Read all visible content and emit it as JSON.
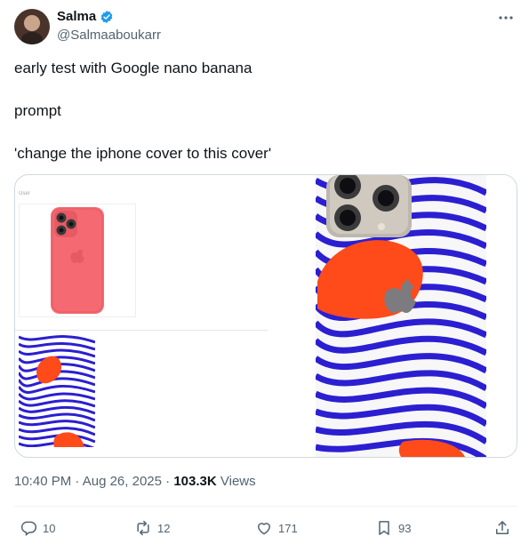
{
  "tweet": {
    "author_name": "Salma",
    "author_handle": "@Salmaaboukarr",
    "text_lines": [
      "early test with Google nano banana",
      "prompt",
      "'change the iphone cover to this cover'"
    ],
    "media_label": "User",
    "time": "10:40 PM",
    "date": "Aug 26, 2025",
    "views_count": "103.3K",
    "views_label": "Views"
  },
  "actions": {
    "replies": "10",
    "reposts": "12",
    "likes": "171",
    "bookmarks": "93"
  },
  "colors": {
    "verified": "#1d9bf0",
    "secondary_text": "#536471",
    "case_pink": "#f56a72",
    "wave_blue": "#2b1fd1",
    "blob_orange": "#ff4a1a"
  },
  "icons": [
    "verified-badge-icon",
    "more-icon",
    "reply-icon",
    "repost-icon",
    "like-icon",
    "bookmark-icon",
    "share-icon"
  ]
}
